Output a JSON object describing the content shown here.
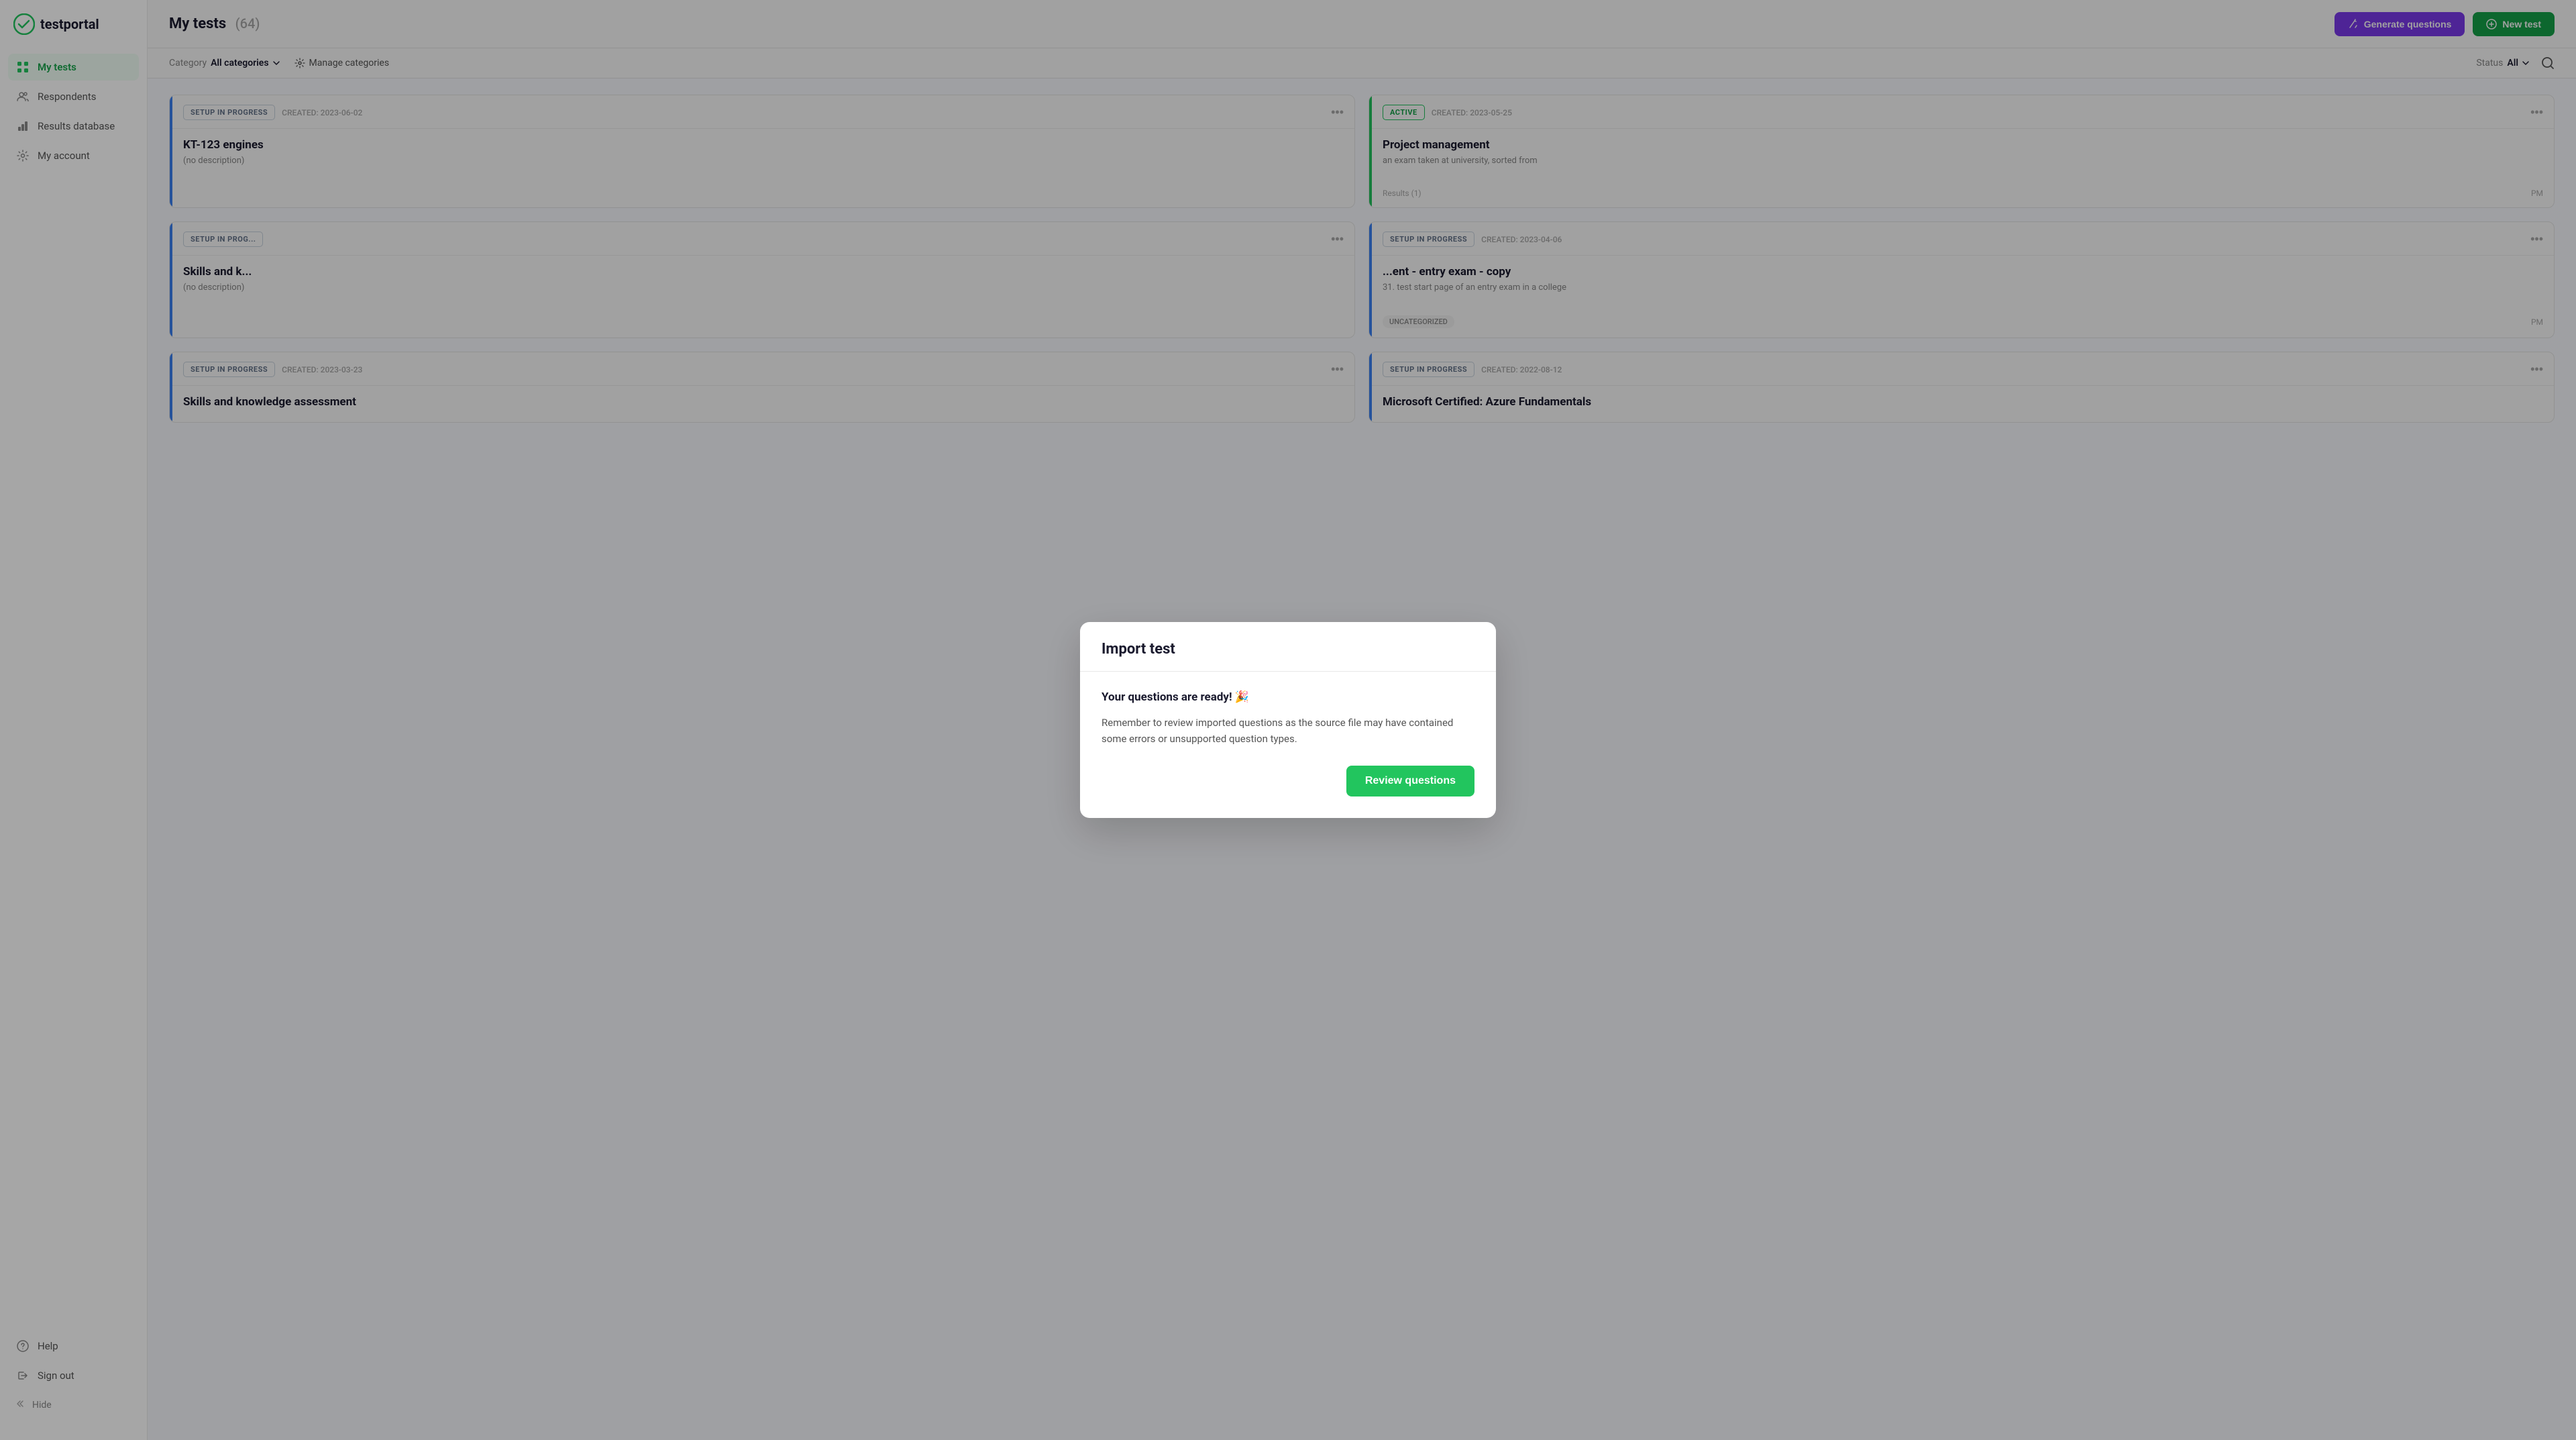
{
  "app": {
    "logo_text": "testportal"
  },
  "sidebar": {
    "items": [
      {
        "id": "my-tests",
        "label": "My tests",
        "icon": "grid-icon",
        "active": true
      },
      {
        "id": "respondents",
        "label": "Respondents",
        "icon": "people-icon",
        "active": false
      },
      {
        "id": "results-database",
        "label": "Results database",
        "icon": "chart-icon",
        "active": false
      },
      {
        "id": "my-account",
        "label": "My account",
        "icon": "gear-icon",
        "active": false
      }
    ],
    "bottom_items": [
      {
        "id": "help",
        "label": "Help",
        "icon": "question-icon"
      },
      {
        "id": "sign-out",
        "label": "Sign out",
        "icon": "signout-icon"
      }
    ],
    "hide_label": "Hide"
  },
  "header": {
    "title": "My tests",
    "count": "(64)",
    "generate_btn": "Generate questions",
    "new_test_btn": "New test"
  },
  "toolbar": {
    "category_label": "Category",
    "category_value": "All categories",
    "manage_label": "Manage categories",
    "status_label": "Status",
    "status_value": "All"
  },
  "cards": [
    {
      "id": "card-1",
      "status": "SETUP IN PROGRESS",
      "status_type": "setup",
      "created": "CREATED: 2023-06-02",
      "title": "KT-123 engines",
      "description": "(no description)",
      "border_color": "blue"
    },
    {
      "id": "card-2",
      "status": "ACTIVE",
      "status_type": "active",
      "created": "CREATED: 2023-05-25",
      "title": "Project management",
      "description": "an exam taken at university, sorted from",
      "results": "Results (1)",
      "time": "PM",
      "border_color": "green"
    },
    {
      "id": "card-3",
      "status": "SETUP IN PROG...",
      "status_type": "setup",
      "created": "",
      "title": "Skills and k...",
      "description": "(no description)",
      "border_color": "blue"
    },
    {
      "id": "card-4",
      "status": "SETUP IN PROGRESS",
      "status_type": "setup",
      "created": "CREATED: 2023-04-06",
      "title": "...ent - entry exam - copy",
      "description": "31. test start page of an entry exam in a college",
      "tag": "UNCATEGORIZED",
      "time": "PM",
      "border_color": "blue"
    },
    {
      "id": "card-5",
      "status": "SETUP IN PROGRESS",
      "status_type": "setup",
      "created": "CREATED: 2023-03-23",
      "title": "Skills and knowledge assessment",
      "description": "",
      "border_color": "blue"
    },
    {
      "id": "card-6",
      "status": "SETUP IN PROGRESS",
      "status_type": "setup",
      "created": "CREATED: 2022-08-12",
      "title": "Microsoft Certified: Azure Fundamentals",
      "description": "",
      "border_color": "blue"
    }
  ],
  "modal": {
    "title": "Import test",
    "ready_text": "Your questions are ready! 🎉",
    "description": "Remember to review imported questions as the source file may have contained some errors or unsupported question types.",
    "review_btn": "Review questions"
  }
}
